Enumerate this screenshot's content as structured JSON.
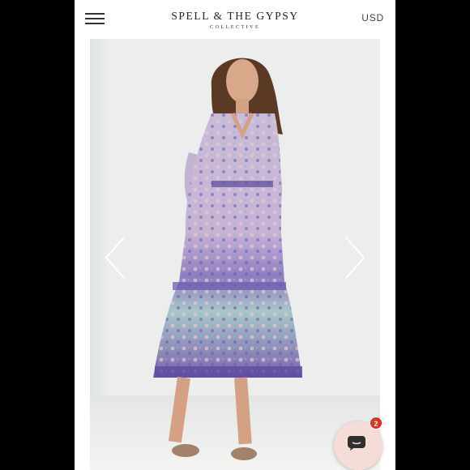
{
  "header": {
    "menu_icon": "hamburger-menu-icon",
    "brand_name": "SPELL & THE GYPSY",
    "brand_sub": "COLLECTIVE",
    "currency": "USD"
  },
  "gallery": {
    "image": "model-wearing-floral-midi-dress",
    "prev_icon": "chevron-left-icon",
    "next_icon": "chevron-right-icon"
  },
  "chat": {
    "icon": "chat-bubble-icon",
    "badge_count": "2",
    "badge_color": "#e03022",
    "bubble_color": "#f6dcd6"
  }
}
